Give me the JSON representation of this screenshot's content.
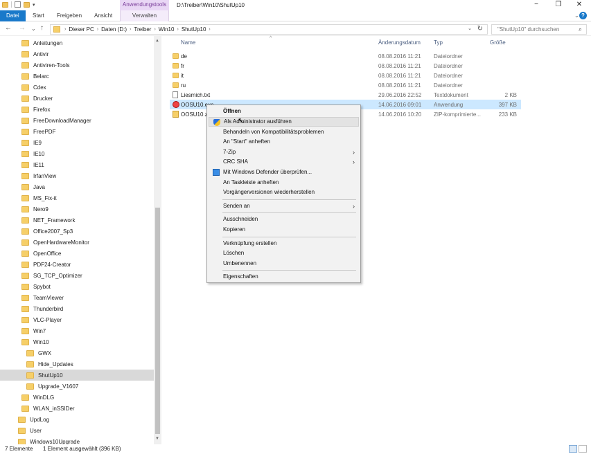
{
  "titlebar": {
    "context_group": "Anwendungstools",
    "path": "D:\\Treiber\\Win10\\ShutUp10",
    "minimize": "−",
    "maximize": "❐",
    "close": "✕"
  },
  "ribbon": {
    "tabs": [
      "Datei",
      "Start",
      "Freigeben",
      "Ansicht"
    ],
    "context_tab": "Verwalten",
    "expand": "⌄",
    "help": "?"
  },
  "nav": {
    "back": "←",
    "forward": "→",
    "recent": "⌄",
    "up": "↑",
    "breadcrumbs": [
      "Dieser PC",
      "Daten (D:)",
      "Treiber",
      "Win10",
      "ShutUp10"
    ],
    "search_placeholder": "\"ShutUp10\" durchsuchen"
  },
  "tree": {
    "items": [
      {
        "label": "Anleitungen",
        "level": 1
      },
      {
        "label": "Antivir",
        "level": 1
      },
      {
        "label": "Antiviren-Tools",
        "level": 1
      },
      {
        "label": "Belarc",
        "level": 1
      },
      {
        "label": "Cdex",
        "level": 1
      },
      {
        "label": "Drucker",
        "level": 1
      },
      {
        "label": "Firefox",
        "level": 1
      },
      {
        "label": "FreeDownloadManager",
        "level": 1
      },
      {
        "label": "FreePDF",
        "level": 1
      },
      {
        "label": "IE9",
        "level": 1
      },
      {
        "label": "IE10",
        "level": 1
      },
      {
        "label": "IE11",
        "level": 1
      },
      {
        "label": "IrfanView",
        "level": 1
      },
      {
        "label": "Java",
        "level": 1
      },
      {
        "label": "MS_Fix-it",
        "level": 1
      },
      {
        "label": "Nero9",
        "level": 1
      },
      {
        "label": "NET_Framework",
        "level": 1
      },
      {
        "label": "Office2007_Sp3",
        "level": 1
      },
      {
        "label": "OpenHardwareMonitor",
        "level": 1
      },
      {
        "label": "OpenOffice",
        "level": 1
      },
      {
        "label": "PDF24-Creator",
        "level": 1
      },
      {
        "label": "SG_TCP_Optimizer",
        "level": 1
      },
      {
        "label": "Spybot",
        "level": 1
      },
      {
        "label": "TeamViewer",
        "level": 1
      },
      {
        "label": "Thunderbird",
        "level": 1
      },
      {
        "label": "VLC-Player",
        "level": 1
      },
      {
        "label": "Win7",
        "level": 1
      },
      {
        "label": "Win10",
        "level": 1
      },
      {
        "label": "GWX",
        "level": 2
      },
      {
        "label": "Hide_Updates",
        "level": 2
      },
      {
        "label": "ShutUp10",
        "level": 2,
        "selected": true
      },
      {
        "label": "Upgrade_V1607",
        "level": 2
      },
      {
        "label": "WinDLG",
        "level": 1
      },
      {
        "label": "WLAN_inSSIDer",
        "level": 1
      },
      {
        "label": "UpdLog",
        "level": 0
      },
      {
        "label": "User",
        "level": 0
      },
      {
        "label": "Windows10Upgrade",
        "level": 0
      }
    ]
  },
  "columns": {
    "name": "Name",
    "date": "Änderungsdatum",
    "type": "Typ",
    "size": "Größe"
  },
  "files": [
    {
      "name": "de",
      "date": "08.08.2016 11:21",
      "type": "Dateiordner",
      "size": "",
      "icon": "folder-icon"
    },
    {
      "name": "fr",
      "date": "08.08.2016 11:21",
      "type": "Dateiordner",
      "size": "",
      "icon": "folder-icon"
    },
    {
      "name": "it",
      "date": "08.08.2016 11:21",
      "type": "Dateiordner",
      "size": "",
      "icon": "folder-icon"
    },
    {
      "name": "ru",
      "date": "08.08.2016 11:21",
      "type": "Dateiordner",
      "size": "",
      "icon": "folder-icon"
    },
    {
      "name": "Liesmich.txt",
      "date": "29.06.2016 22:52",
      "type": "Textdokument",
      "size": "2 KB",
      "icon": "text-file-icon"
    },
    {
      "name": "OOSU10.exe",
      "date": "14.06.2016 09:01",
      "type": "Anwendung",
      "size": "397 KB",
      "icon": "app-icon",
      "selected": true
    },
    {
      "name": "OOSU10.zip",
      "date": "14.06.2016 10:20",
      "type": "ZIP-komprimierte...",
      "size": "233 KB",
      "icon": "zip-icon"
    }
  ],
  "context_menu": {
    "items": [
      {
        "label": "Öffnen",
        "bold": true
      },
      {
        "label": "Als Administrator ausführen",
        "icon": "uac-shield-icon",
        "hover": true
      },
      {
        "label": "Behandeln von Kompatibilitätsproblemen"
      },
      {
        "label": "An \"Start\" anheften"
      },
      {
        "label": "7-Zip",
        "submenu": true
      },
      {
        "label": "CRC SHA",
        "submenu": true
      },
      {
        "label": "Mit Windows Defender überprüfen...",
        "icon": "defender-icon"
      },
      {
        "label": "An Taskleiste anheften"
      },
      {
        "label": "Vorgängerversionen wiederherstellen"
      },
      {
        "separator": true
      },
      {
        "label": "Senden an",
        "submenu": true
      },
      {
        "separator": true
      },
      {
        "label": "Ausschneiden"
      },
      {
        "label": "Kopieren"
      },
      {
        "separator": true
      },
      {
        "label": "Verknüpfung erstellen"
      },
      {
        "label": "Löschen"
      },
      {
        "label": "Umbenennen"
      },
      {
        "separator": true
      },
      {
        "label": "Eigenschaften"
      }
    ]
  },
  "status": {
    "count": "7 Elemente",
    "selection": "1 Element ausgewählt (396 KB)"
  }
}
